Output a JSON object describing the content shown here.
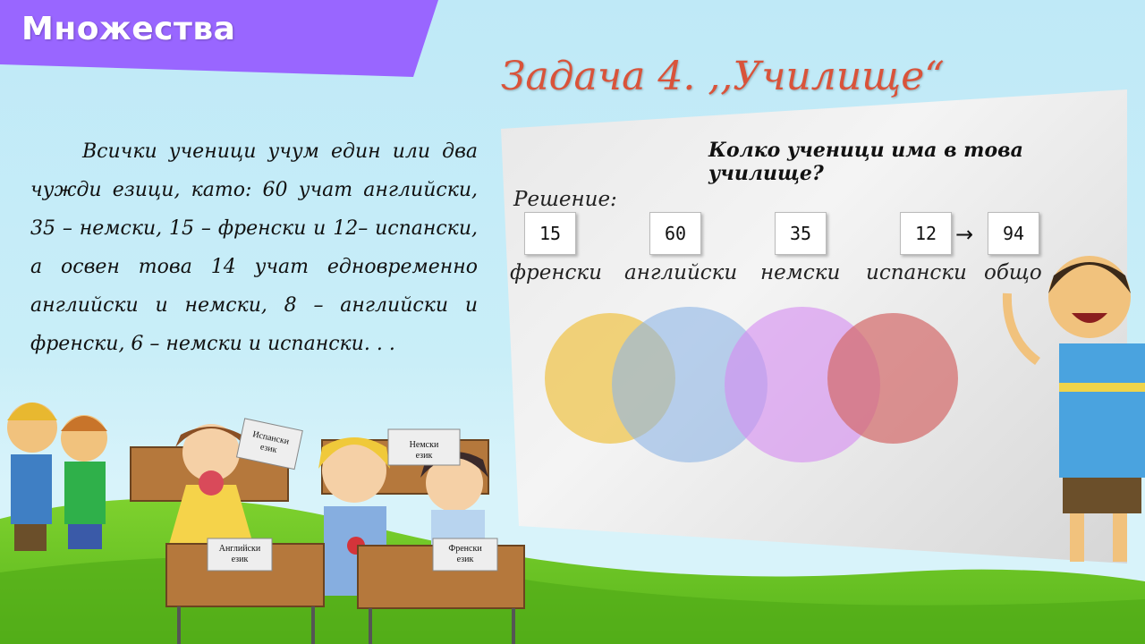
{
  "header": {
    "title": "Множества"
  },
  "task": {
    "title": "Задача 4. ,,Училище“"
  },
  "problem": {
    "text": "Всички ученици учум един или два чужди езици, като: 60 учат английски, 35 – немски, 15 – френски и 12– испански, а освен това 14 учат едновременно английски и немски, 8 – английски и френски, 6 – немски и испански. . ."
  },
  "board": {
    "question": "Колко ученици има в това училище?",
    "solution_label": "Решение:",
    "boxes": [
      {
        "value": "15",
        "label": "френски"
      },
      {
        "value": "60",
        "label": "английски"
      },
      {
        "value": "35",
        "label": "немски"
      },
      {
        "value": "12",
        "label": "испански"
      },
      {
        "value": "94",
        "label": "общо"
      }
    ],
    "arrow": "→"
  },
  "venn": {
    "colors": [
      "#f0c650",
      "#8fb6e6",
      "#d68cf2",
      "#d46a6a"
    ]
  },
  "signs": {
    "spanish": "Испански език",
    "german": "Немски език",
    "english": "Английски език",
    "french": "Френски език"
  }
}
